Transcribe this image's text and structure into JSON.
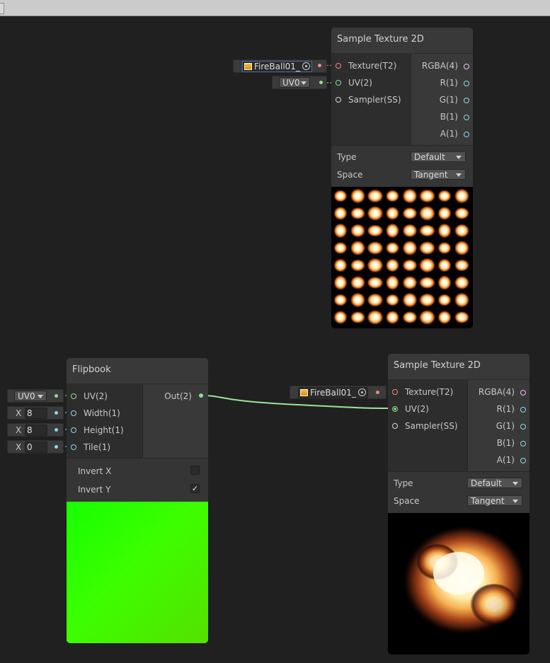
{
  "colors": {
    "background": "#202020",
    "node_body": "#393939",
    "port_texture": "#f08a8a",
    "port_vector2": "#8ae08a",
    "port_vector1": "#8ad6f0",
    "port_vector4": "#f0c0f0",
    "wire_uv": "#9be59b",
    "flipbook_preview_green": "#3cff00"
  },
  "top_node": {
    "title": "Sample Texture 2D",
    "inputs": [
      "Texture(T2)",
      "UV(2)",
      "Sampler(SS)"
    ],
    "outputs": [
      "RGBA(4)",
      "R(1)",
      "G(1)",
      "B(1)",
      "A(1)"
    ],
    "props": {
      "type_label": "Type",
      "type_value": "Default",
      "space_label": "Space",
      "space_value": "Tangent"
    },
    "texture_field": "FireBall01_",
    "uv_value": "UV0",
    "preview": "fireball-sprite-sheet-8x8"
  },
  "flipbook_node": {
    "title": "Flipbook",
    "inputs": [
      "UV(2)",
      "Width(1)",
      "Height(1)",
      "Tile(1)"
    ],
    "output": "Out(2)",
    "uv_value": "UV0",
    "x_label": "X",
    "width_value": "8",
    "height_value": "8",
    "tile_value": "0",
    "invert_x_label": "Invert X",
    "invert_x_checked": false,
    "invert_y_label": "Invert Y",
    "invert_y_checked": true,
    "check_glyph": "✓"
  },
  "bottom_node": {
    "title": "Sample Texture 2D",
    "inputs": [
      "Texture(T2)",
      "UV(2)",
      "Sampler(SS)"
    ],
    "outputs": [
      "RGBA(4)",
      "R(1)",
      "G(1)",
      "B(1)",
      "A(1)"
    ],
    "props": {
      "type_label": "Type",
      "type_value": "Default",
      "space_label": "Space",
      "space_value": "Tangent"
    },
    "texture_field": "FireBall01_",
    "preview": "fireball-single-frame"
  }
}
